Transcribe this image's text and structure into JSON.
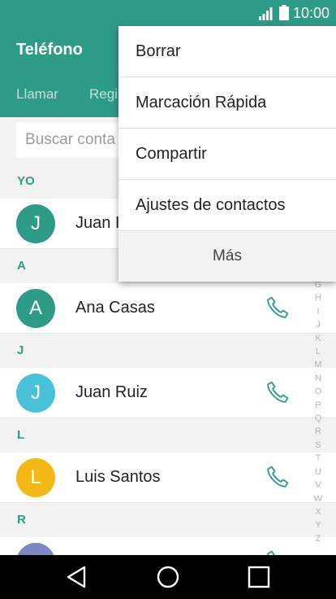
{
  "status": {
    "time": "10:00"
  },
  "app": {
    "title": "Teléfono"
  },
  "tabs": [
    {
      "label": "Llamar"
    },
    {
      "label": "Regi"
    }
  ],
  "search": {
    "placeholder": "Buscar conta"
  },
  "sections": [
    {
      "letter": "YO",
      "contacts": [
        {
          "initial": "J",
          "name": "Juan I",
          "color": "#2e9b86",
          "call_icon": false
        }
      ]
    },
    {
      "letter": "A",
      "contacts": [
        {
          "initial": "A",
          "name": "Ana Casas",
          "color": "#2e9b86",
          "call_icon": true
        }
      ]
    },
    {
      "letter": "J",
      "contacts": [
        {
          "initial": "J",
          "name": "Juan Ruiz",
          "color": "#48c1d9",
          "call_icon": true
        }
      ]
    },
    {
      "letter": "L",
      "contacts": [
        {
          "initial": "L",
          "name": "Luis Santos",
          "color": "#f2b916",
          "call_icon": true
        }
      ]
    },
    {
      "letter": "R",
      "contacts": [
        {
          "initial": "",
          "name": "",
          "color": "#7d87c4",
          "call_icon": true
        }
      ]
    }
  ],
  "index_letters": [
    "G",
    "H",
    "I",
    "J",
    "K",
    "L",
    "M",
    "N",
    "O",
    "P",
    "Q",
    "R",
    "S",
    "T",
    "U",
    "V",
    "W",
    "X",
    "Y",
    "Z"
  ],
  "menu": {
    "items": [
      "Borrar",
      "Marcación Rápida",
      "Compartir",
      "Ajustes de contactos"
    ],
    "more_label": "Más"
  },
  "colors": {
    "accent": "#2e9b86"
  }
}
